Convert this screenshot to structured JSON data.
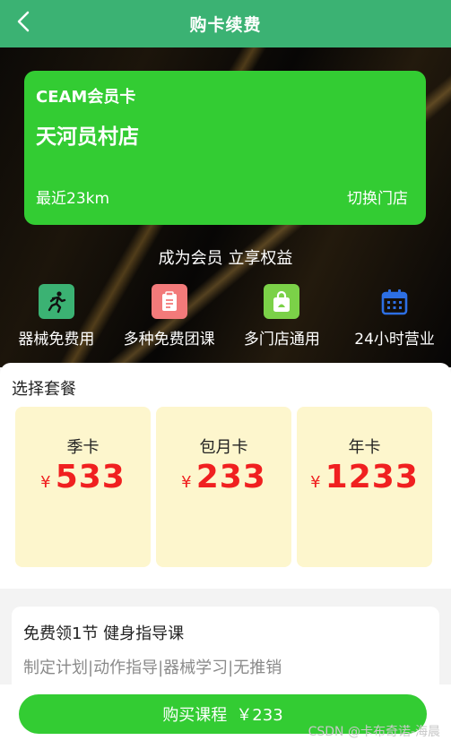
{
  "header": {
    "title": "购卡续费",
    "back_icon": "back-chevron-icon"
  },
  "card": {
    "brand": "CEAM会员卡",
    "store": "天河员村店",
    "distance": "最近23km",
    "switch_label": "切换门店",
    "color": "#33cc33"
  },
  "tagline": "成为会员 立享权益",
  "features": [
    {
      "icon": "running-icon",
      "label": "器械免费用",
      "color": "#3bb273"
    },
    {
      "icon": "clipboard-icon",
      "label": "多种免费团课",
      "color": "#f27a7a"
    },
    {
      "icon": "shopping-bag-icon",
      "label": "多门店通用",
      "color": "#7bd148"
    },
    {
      "icon": "calendar-icon",
      "label": "24小时营业",
      "color": "#2d6fe3"
    }
  ],
  "plans": {
    "title": "选择套餐",
    "items": [
      {
        "name": "季卡",
        "currency": "¥",
        "price": "533"
      },
      {
        "name": "包月卡",
        "currency": "¥",
        "price": "233"
      },
      {
        "name": "年卡",
        "currency": "¥",
        "price": "1233"
      }
    ]
  },
  "course": {
    "title": "免费领1节 健身指导课",
    "subtitle": "制定计划|动作指导|器械学习|无推销"
  },
  "buy": {
    "label": "购买课程",
    "price": "￥233"
  },
  "watermark": "CSDN @卡布奇诺-海晨"
}
